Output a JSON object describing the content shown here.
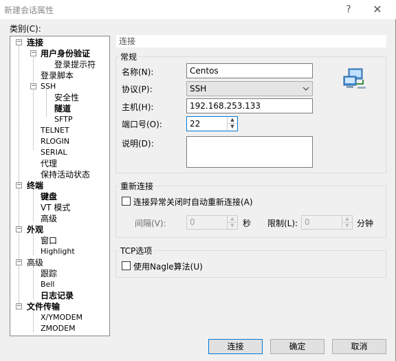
{
  "window": {
    "title": "新建会话属性",
    "help": "?",
    "close": "✕"
  },
  "category_label": "类别(C):",
  "tree": {
    "connection": "连接",
    "user_auth": "用户身份验证",
    "login_prompt": "登录提示符",
    "login_script": "登录脚本",
    "ssh": "SSH",
    "security": "安全性",
    "tunnel": "隧道",
    "sftp": "SFTP",
    "telnet": "TELNET",
    "rlogin": "RLOGIN",
    "serial": "SERIAL",
    "proxy": "代理",
    "keepalive": "保持活动状态",
    "terminal": "终端",
    "keyboard": "键盘",
    "vt_mode": "VT 模式",
    "advanced": "高级",
    "appearance": "外观",
    "window": "窗口",
    "highlight": "Highlight",
    "advanced2": "高级",
    "trace": "跟踪",
    "bell": "Bell",
    "log": "日志记录",
    "file_transfer": "文件传输",
    "xymodem": "X/YMODEM",
    "zmodem": "ZMODEM"
  },
  "header": "连接",
  "general": {
    "title": "常规",
    "name_label": "名称(N):",
    "name_value": "Centos",
    "protocol_label": "协议(P):",
    "protocol_value": "SSH",
    "host_label": "主机(H):",
    "host_value": "192.168.253.133",
    "port_label": "端口号(O):",
    "port_value": "22",
    "desc_label": "说明(D):",
    "desc_value": ""
  },
  "reconnect": {
    "title": "重新连接",
    "auto_label": "连接异常关闭时自动重新连接(A)",
    "interval_label": "间隔(V):",
    "interval_value": "0",
    "interval_unit": "秒",
    "limit_label": "限制(L):",
    "limit_value": "0",
    "limit_unit": "分钟"
  },
  "tcp": {
    "title": "TCP选项",
    "nagle_label": "使用Nagle算法(U)"
  },
  "buttons": {
    "connect": "连接",
    "ok": "确定",
    "cancel": "取消"
  }
}
